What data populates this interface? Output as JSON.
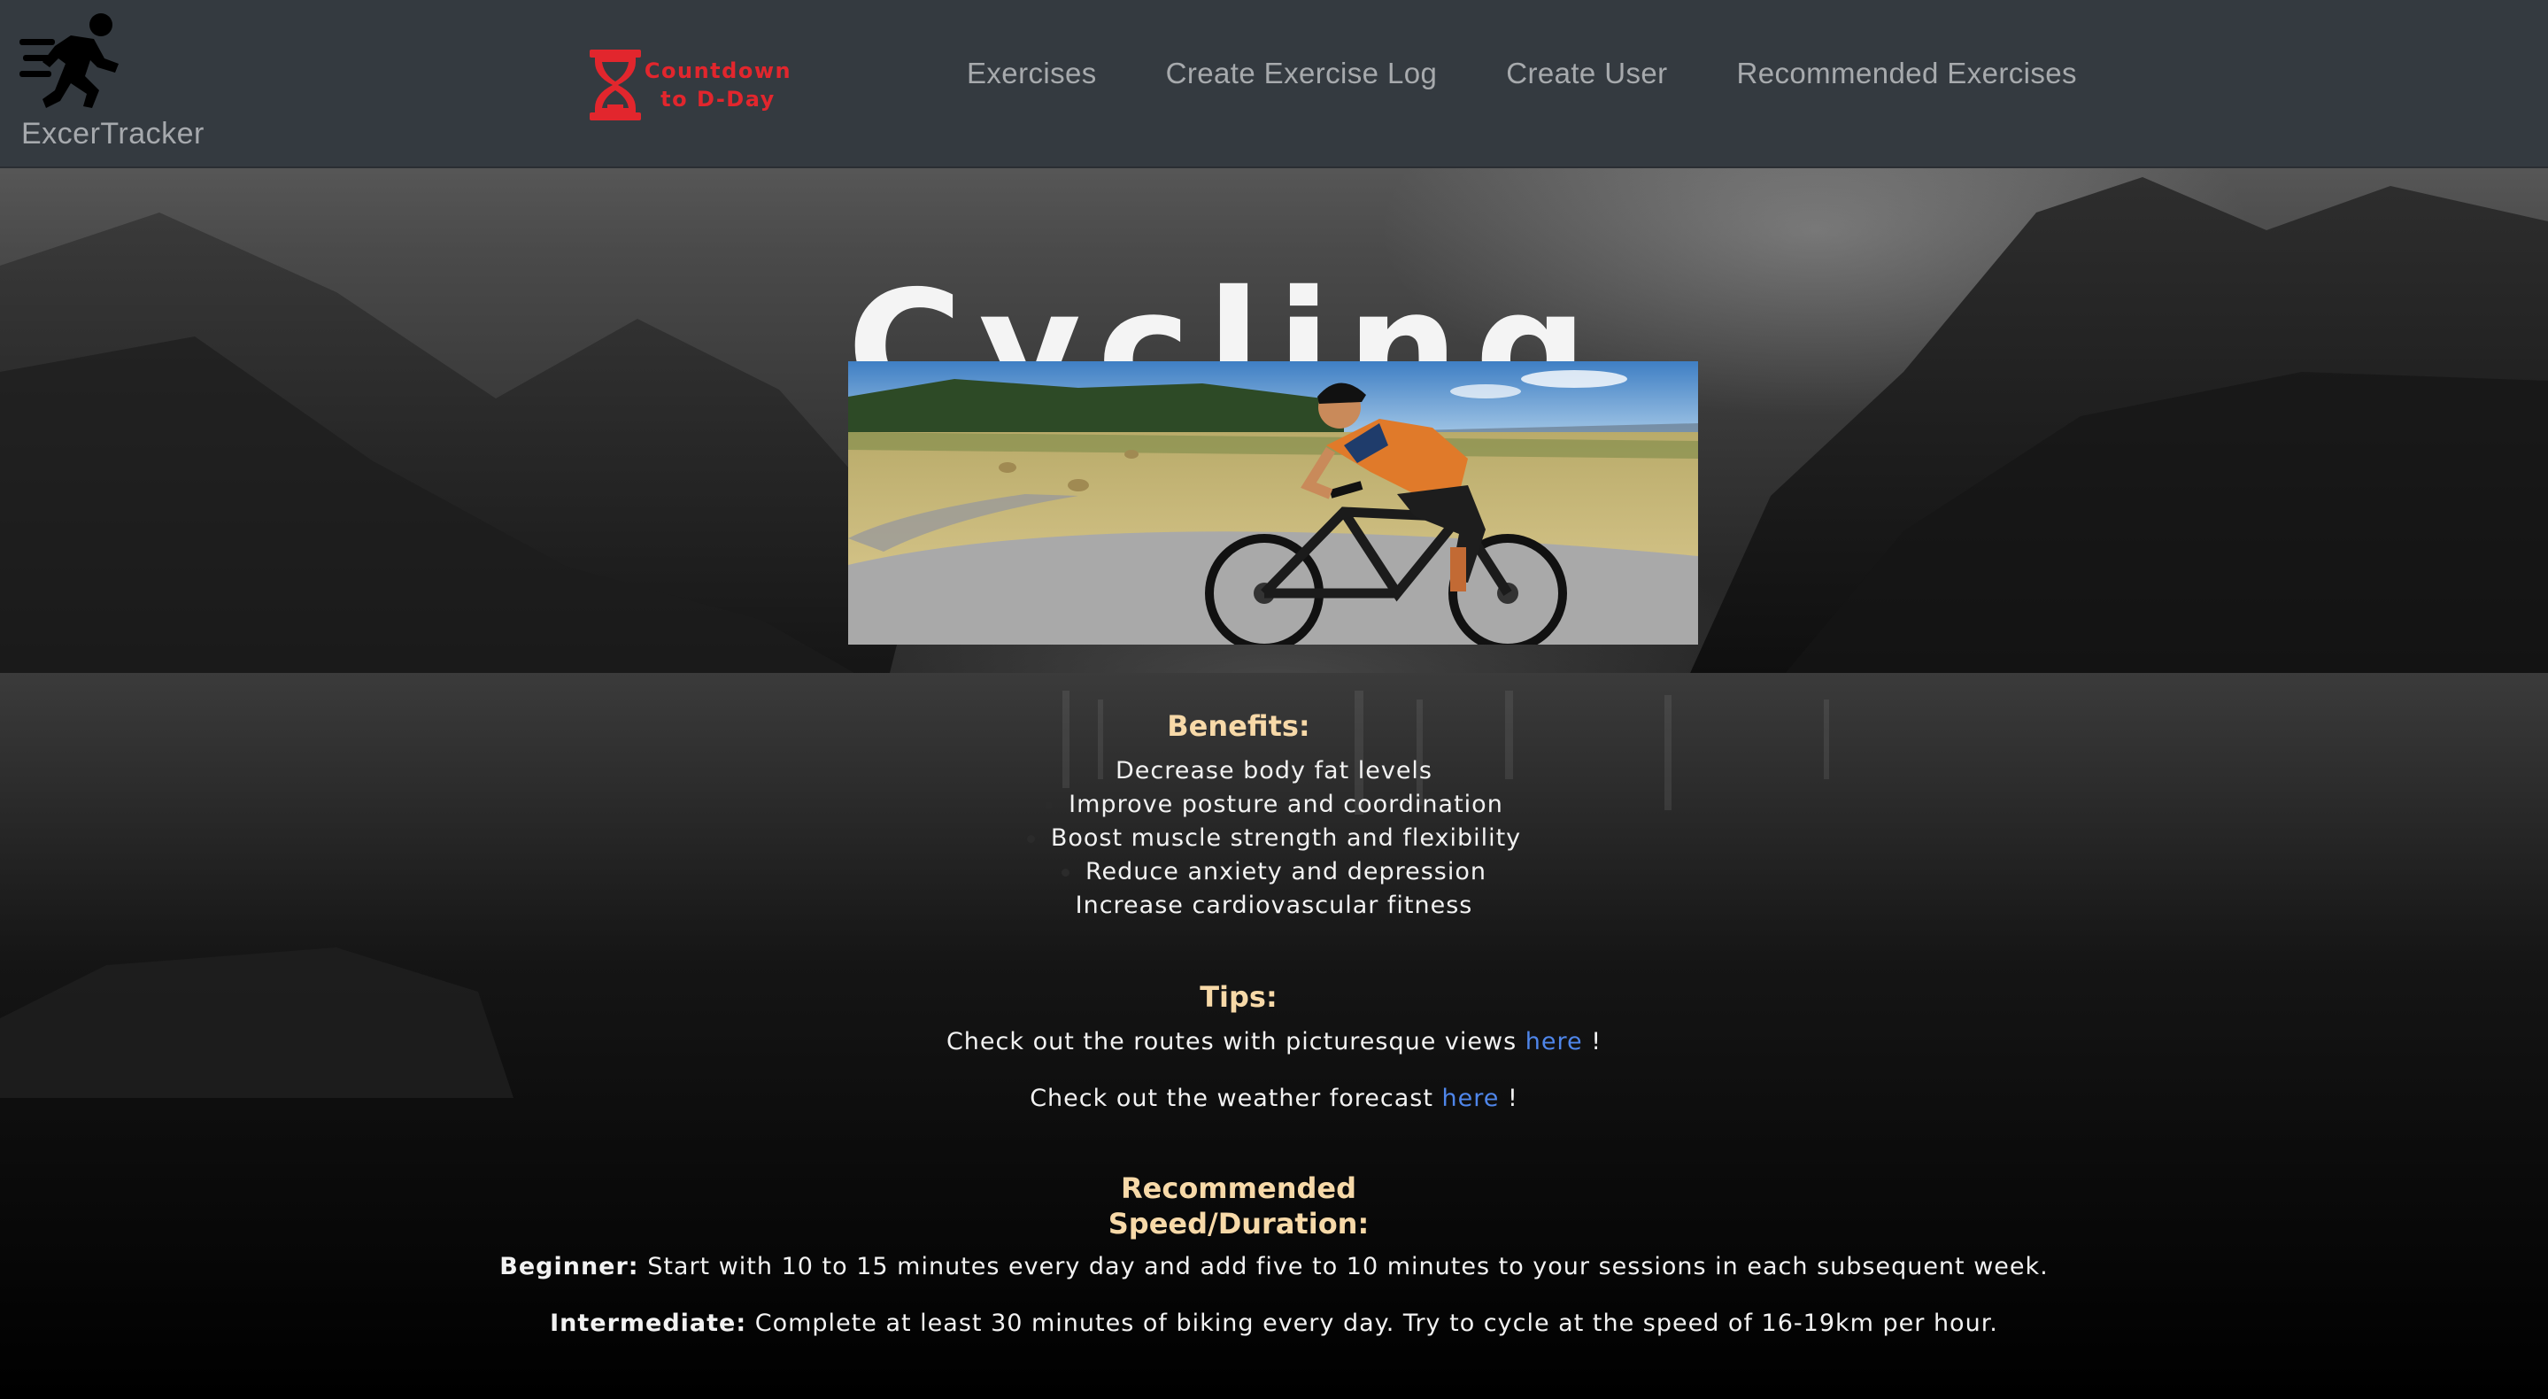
{
  "brand": {
    "name": "ExcerTracker",
    "icon": "running-person-icon"
  },
  "countdown": {
    "label_line1": "Countdown",
    "label_line2": "to D-Day",
    "icon": "hourglass-icon",
    "color": "#e2262d"
  },
  "nav": {
    "items": [
      {
        "label": "Exercises"
      },
      {
        "label": "Create Exercise Log"
      },
      {
        "label": "Create User"
      },
      {
        "label": "Recommended Exercises"
      }
    ]
  },
  "page": {
    "title": "Cycling",
    "benefits": {
      "heading": "Benefits:",
      "items": [
        "Decrease body fat levels",
        "Improve posture and coordination",
        "Boost muscle strength and flexibility",
        "Reduce anxiety and depression",
        "Increase cardiovascular fitness"
      ]
    },
    "tips": {
      "heading": "Tips:",
      "lines": [
        {
          "text": "Check out the routes with picturesque views",
          "link": "here",
          "suffix": "!"
        },
        {
          "text": "Check out the weather forecast",
          "link": "here",
          "suffix": "!"
        }
      ]
    },
    "recommended": {
      "heading_line1": "Recommended",
      "heading_line2": "Speed/Duration:",
      "levels": [
        {
          "label": "Beginner:",
          "text": "Start with 10 to 15 minutes every day and add five to 10 minutes to your sessions in each subsequent week."
        },
        {
          "label": "Intermediate:",
          "text": "Complete at least 30 minutes of biking every day. Try to cycle at the speed of 16-19km per hour."
        }
      ]
    }
  },
  "colors": {
    "navbar": "#343a40",
    "heading_accent": "#f7d9a8",
    "link": "#4f86ea"
  }
}
